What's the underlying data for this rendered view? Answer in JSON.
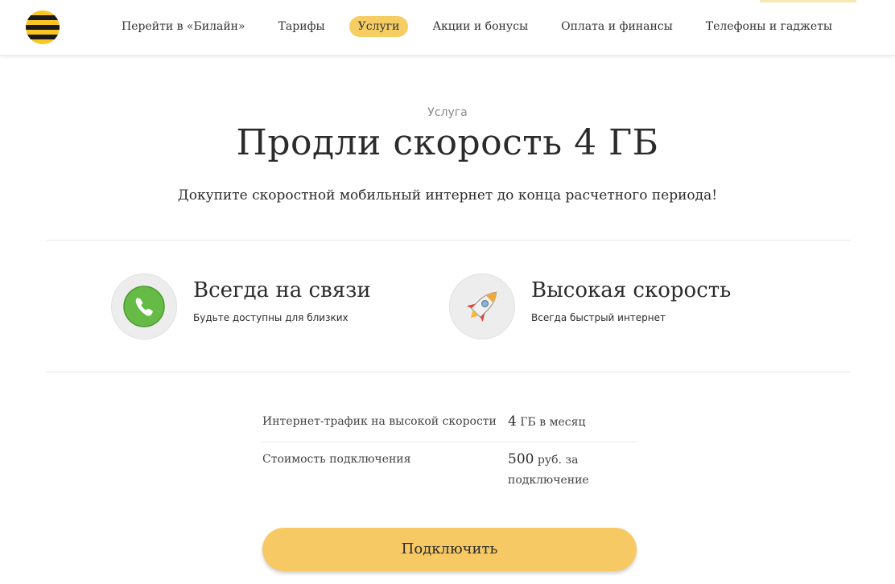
{
  "header": {
    "logo_icon": "beeline-logo-icon",
    "nav": [
      {
        "label": "Перейти в «Билайн»",
        "active": false
      },
      {
        "label": "Тарифы",
        "active": false
      },
      {
        "label": "Услуги",
        "active": true
      },
      {
        "label": "Акции и бонусы",
        "active": false
      },
      {
        "label": "Оплата и финансы",
        "active": false
      },
      {
        "label": "Телефоны и гаджеты",
        "active": false
      }
    ]
  },
  "service": {
    "kind": "Услуга",
    "title": "Продли скорость 4 ГБ",
    "description": "Докупите скоростной мобильный интернет до конца расчетного периода!"
  },
  "features": [
    {
      "icon": "phone-icon",
      "title": "Всегда на связи",
      "subtitle": "Будьте доступны для близких"
    },
    {
      "icon": "rocket-icon",
      "title": "Высокая скорость",
      "subtitle": "Всегда быстрый интернет"
    }
  ],
  "params": [
    {
      "name": "Интернет-трафик на высокой скорости",
      "value_num": "4",
      "value_unit": "ГБ в месяц",
      "value_extra": ""
    },
    {
      "name": "Стоимость подключения",
      "value_num": "500",
      "value_unit": "руб. за",
      "value_extra": "подключение"
    }
  ],
  "cta": {
    "label": "Подключить"
  },
  "colors": {
    "brand_yellow": "#f5cd63",
    "button_yellow": "#f7c964",
    "text": "#2b2b2b",
    "muted": "#8a8a8a",
    "phone_green": "#66bb46"
  }
}
